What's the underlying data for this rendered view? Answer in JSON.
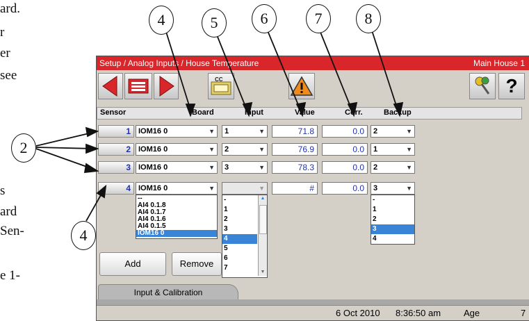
{
  "doc": {
    "lines": [
      "ard.",
      "r",
      "er",
      "see",
      "s",
      "ard",
      "Sen-",
      "e 1-"
    ]
  },
  "callouts": [
    "4",
    "5",
    "6",
    "7",
    "8",
    "2",
    "4"
  ],
  "window": {
    "breadcrumb": "Setup / Analog Inputs / House Temperature",
    "location": "Main House 1"
  },
  "toolbar": {
    "cc_label": "CC",
    "warning_icon": "warning-icon",
    "help_label": "?"
  },
  "table": {
    "headers": [
      "Sensor",
      "Board",
      "Input",
      "Value",
      "Corr.",
      "Backup"
    ],
    "rows": [
      {
        "sensor": "1",
        "board": "IOM16 0",
        "input": "1",
        "value": "71.8",
        "corr": "0.0",
        "backup": "2"
      },
      {
        "sensor": "2",
        "board": "IOM16 0",
        "input": "2",
        "value": "76.9",
        "corr": "0.0",
        "backup": "1"
      },
      {
        "sensor": "3",
        "board": "IOM16 0",
        "input": "3",
        "value": "78.3",
        "corr": "0.0",
        "backup": "2"
      },
      {
        "sensor": "4",
        "board": "IOM16 0",
        "input": "",
        "value": "#",
        "corr": "0.0",
        "backup": "3"
      }
    ]
  },
  "board_list": [
    "--",
    "AI4 0.1.8",
    "AI4 0.1.7",
    "AI4 0.1.6",
    "AI4 0.1.5",
    "IOM16 0"
  ],
  "input_list": [
    "-",
    "1",
    "2",
    "3",
    "4",
    "5",
    "6",
    "7"
  ],
  "backup_list": [
    "-",
    "1",
    "2",
    "3",
    "4"
  ],
  "buttons": {
    "add": "Add",
    "remove": "Remove"
  },
  "tabs": {
    "active": "Input & Calibration"
  },
  "status": {
    "date": "6 Oct 2010",
    "time": "8:36:50 am",
    "age_label": "Age",
    "age_value": "7"
  }
}
